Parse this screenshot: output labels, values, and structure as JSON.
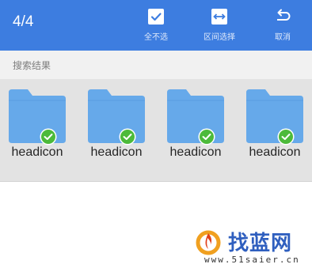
{
  "header": {
    "count": "4/4",
    "actions": [
      {
        "label": "全不选",
        "icon": "checkbox-checked-icon"
      },
      {
        "label": "区间选择",
        "icon": "range-select-icon"
      },
      {
        "label": "取消",
        "icon": "undo-arrow-icon"
      }
    ]
  },
  "section": {
    "label": "搜索结果"
  },
  "items": [
    {
      "name": "headicon",
      "selected": true
    },
    {
      "name": "headicon",
      "selected": true
    },
    {
      "name": "headicon",
      "selected": true
    },
    {
      "name": "headicon",
      "selected": true
    }
  ],
  "watermark": {
    "title": "找蓝网",
    "url": "www.51saier.cn"
  },
  "colors": {
    "accent": "#3d7de0",
    "folder": "#66a9ea",
    "check": "#4cba3a"
  }
}
